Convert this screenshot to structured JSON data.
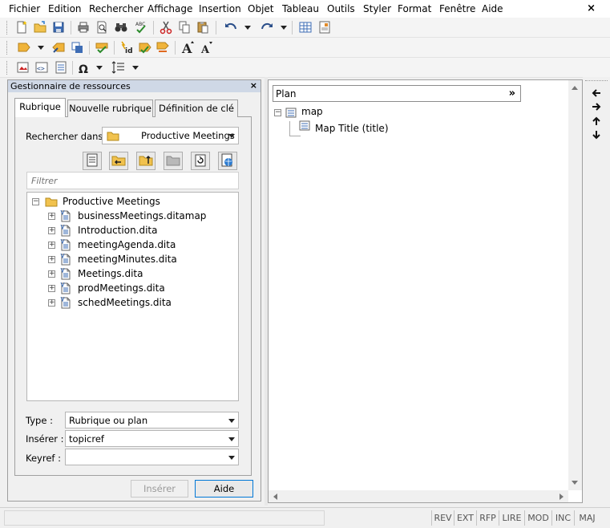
{
  "menu": [
    "Fichier",
    "Edition",
    "Rechercher",
    "Affichage",
    "Insertion",
    "Objet",
    "Tableau",
    "Outils",
    "Styler",
    "Format",
    "Fenêtre",
    "Aide"
  ],
  "window_close": "×",
  "resource_manager": {
    "title": "Gestionnaire de ressources",
    "close": "×",
    "tabs": [
      "Rubrique",
      "Nouvelle rubrique",
      "Définition de clé"
    ],
    "search_in_label": "Rechercher dans :",
    "search_in_value": "Productive Meetings",
    "filter_placeholder": "Filtrer",
    "tree": {
      "root": "Productive Meetings",
      "items": [
        "businessMeetings.ditamap",
        "Introduction.dita",
        "meetingAgenda.dita",
        "meetingMinutes.dita",
        "Meetings.dita",
        "prodMeetings.dita",
        "schedMeetings.dita"
      ]
    },
    "type_label": "Type :",
    "type_value": "Rubrique ou plan",
    "insert_label": "Insérer :",
    "insert_value": "topicref",
    "keyref_label": "Keyref :",
    "keyref_value": "",
    "insert_button": "Insérer",
    "help_button": "Aide"
  },
  "editor": {
    "view_selector": "Plan",
    "view_more": "»",
    "map_label": "map",
    "child_label": "Map Title (title)"
  },
  "status": [
    "REV",
    "EXT",
    "RFP",
    "LIRE",
    "MOD",
    "INC",
    "MAJ"
  ]
}
